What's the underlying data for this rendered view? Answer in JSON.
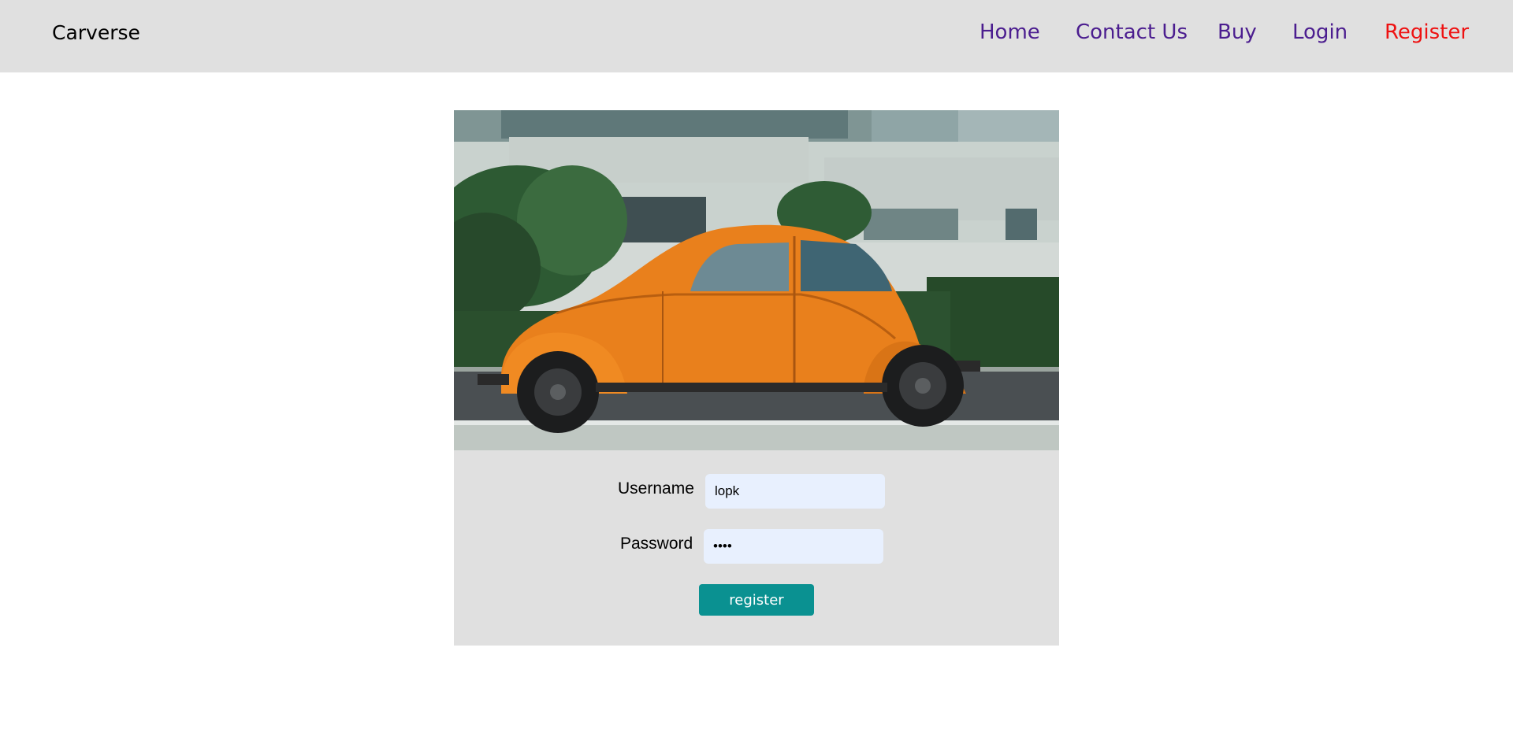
{
  "brand": {
    "name": "Carverse"
  },
  "nav": {
    "items": [
      {
        "label": "Home",
        "color": "#4b1d8f"
      },
      {
        "label": "Contact Us",
        "color": "#4b1d8f"
      },
      {
        "label": "Buy",
        "color": "#4b1d8f"
      },
      {
        "label": "Login",
        "color": "#4b1d8f"
      },
      {
        "label": "Register",
        "color": "#ee1111"
      }
    ]
  },
  "hero_image": {
    "icon": "orange-vintage-car-photo"
  },
  "form": {
    "username_label": "Username",
    "username_value": "lopk",
    "password_label": "Password",
    "password_value": "••••",
    "submit_label": "register",
    "submit_color": "#0a9191"
  }
}
